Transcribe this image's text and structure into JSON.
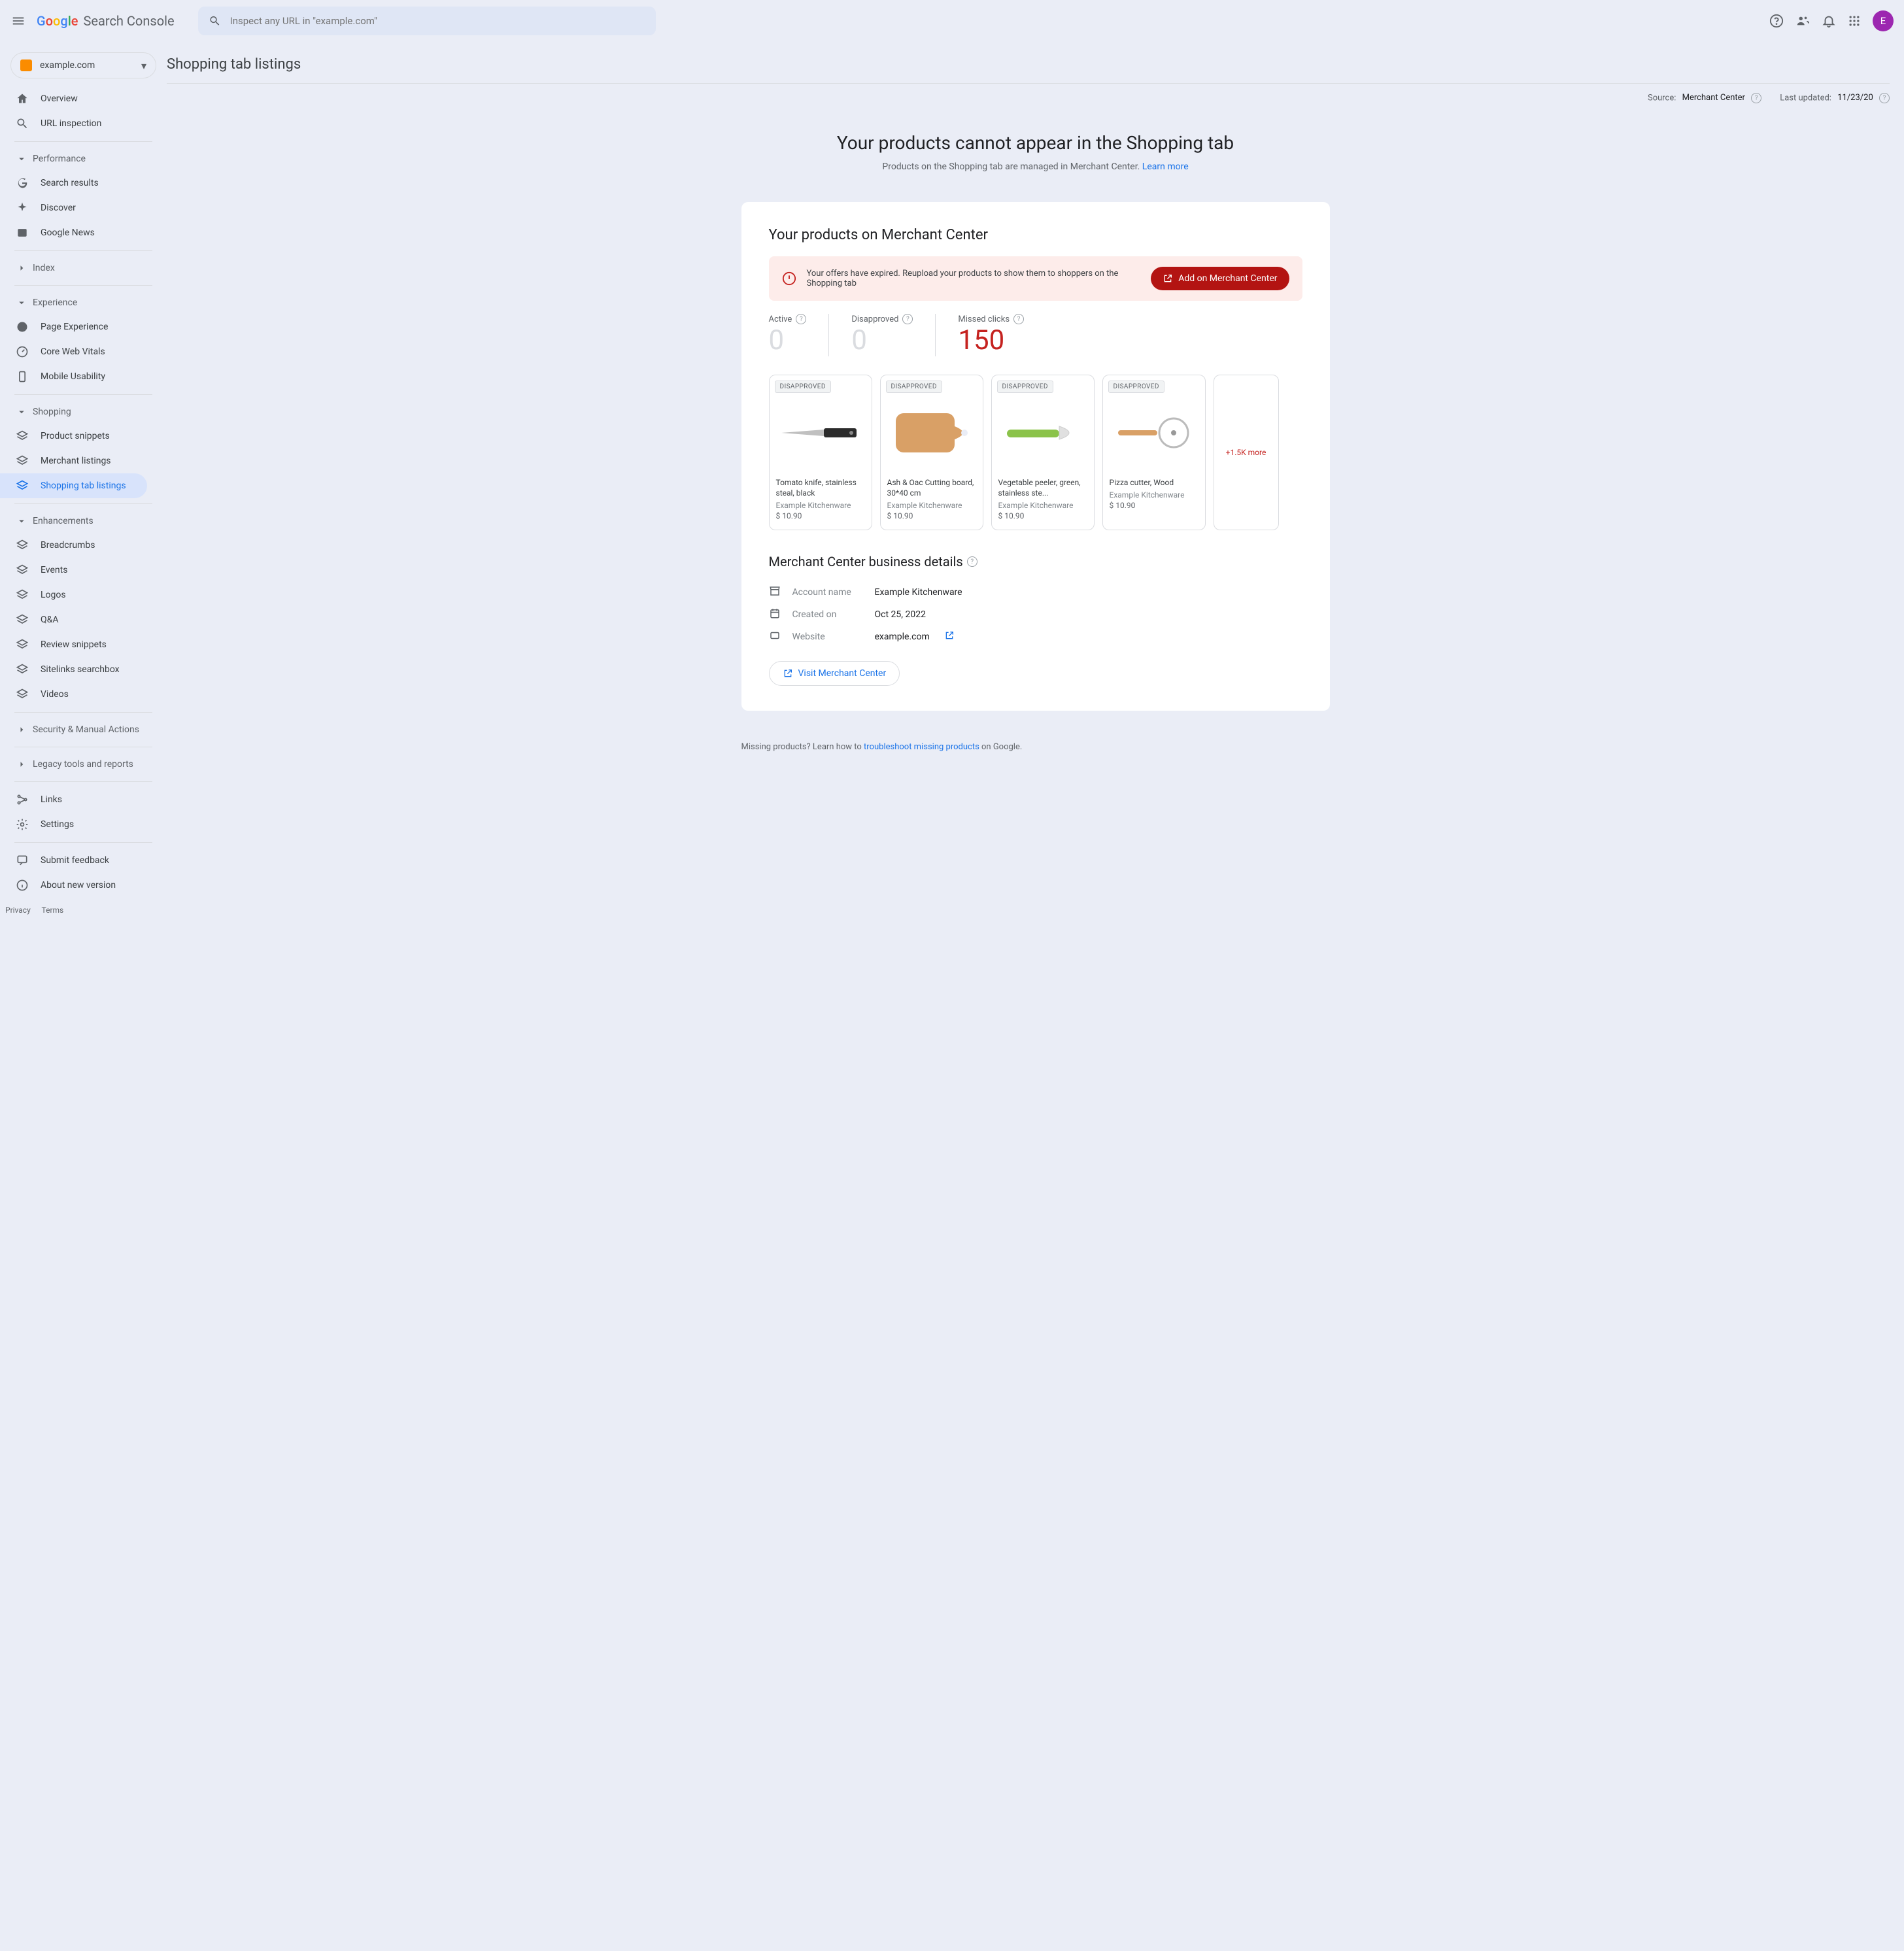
{
  "app_name": "Search Console",
  "search": {
    "placeholder": "Inspect any URL in \"example.com\""
  },
  "avatar_letter": "E",
  "property_selector": {
    "domain": "example.com"
  },
  "sidebar": {
    "overview": "Overview",
    "url_inspection": "URL inspection",
    "groups": {
      "performance": {
        "label": "Performance",
        "items": [
          "Search results",
          "Discover",
          "Google News"
        ]
      },
      "index": "Index",
      "experience": {
        "label": "Experience",
        "items": [
          "Page Experience",
          "Core Web Vitals",
          "Mobile Usability"
        ]
      },
      "shopping": {
        "label": "Shopping",
        "items": [
          "Product snippets",
          "Merchant listings",
          "Shopping tab listings"
        ]
      },
      "enhancements": {
        "label": "Enhancements",
        "items": [
          "Breadcrumbs",
          "Events",
          "Logos",
          "Q&A",
          "Review snippets",
          "Sitelinks searchbox",
          "Videos"
        ]
      },
      "security": "Security & Manual Actions",
      "legacy": "Legacy tools and reports"
    },
    "bottom": {
      "links": "Links",
      "settings": "Settings",
      "feedback": "Submit feedback",
      "about": "About new version"
    }
  },
  "page": {
    "title": "Shopping tab listings",
    "source_label": "Source:",
    "source_value": "Merchant Center",
    "updated_label": "Last updated:",
    "updated_value": "11/23/20",
    "hero_title": "Your products cannot appear in the Shopping tab",
    "hero_text": "Products on the Shopping tab are managed in Merchant Center. ",
    "learn_more": "Learn more",
    "card_title": "Your products on Merchant Center",
    "alert_text": "Your offers have expired. Reupload your products to show them to shoppers on the Shopping tab",
    "alert_button": "Add on Merchant Center",
    "stats": {
      "active": {
        "label": "Active",
        "value": "0"
      },
      "disapproved": {
        "label": "Disapproved",
        "value": "0"
      },
      "missed": {
        "label": "Missed clicks",
        "value": "150"
      }
    },
    "badge": "DISAPPROVED",
    "products": [
      {
        "name": "Tomato knife, stainless steal, black",
        "store": "Example Kitchenware",
        "price": "$ 10.90"
      },
      {
        "name": "Ash & Oac Cutting board, 30*40 cm",
        "store": "Example Kitchenware",
        "price": "$ 10.90"
      },
      {
        "name": "Vegetable peeler, green, stainless ste...",
        "store": "Example Kitchenware",
        "price": "$ 10.90"
      },
      {
        "name": "Pizza cutter, Wood",
        "store": "Example Kitchenware",
        "price": "$ 10.90"
      }
    ],
    "more_label": "+1.5K more",
    "business_title": "Merchant Center business details",
    "details": {
      "account_label": "Account name",
      "account_value": "Example Kitchenware",
      "created_label": "Created on",
      "created_value": "Oct 25, 2022",
      "website_label": "Website",
      "website_value": "example.com"
    },
    "visit_button": "Visit Merchant Center",
    "footer_prefix": "Missing products? Learn how to ",
    "footer_link": "troubleshoot missing products",
    "footer_suffix": " on Google."
  },
  "footer": {
    "privacy": "Privacy",
    "terms": "Terms"
  }
}
